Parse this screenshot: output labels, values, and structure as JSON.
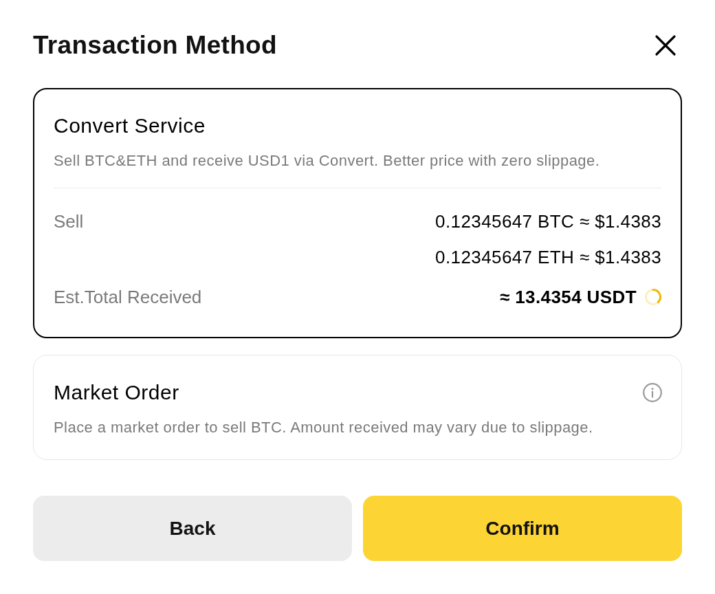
{
  "dialog": {
    "title": "Transaction Method"
  },
  "methods": [
    {
      "kind": "detailed",
      "selected": true,
      "title": "Convert Service",
      "description": "Sell BTC&ETH and receive USD1 via Convert. Better price with zero slippage.",
      "info": false,
      "rows": [
        {
          "kind": "line",
          "label": "Sell",
          "values": [
            "0.12345647 BTC ≈ $1.4383",
            "0.12345647 ETH ≈ $1.4383"
          ],
          "loading": false
        },
        {
          "kind": "total",
          "label": "Est.Total Received",
          "values": [
            "≈ 13.4354 USDT"
          ],
          "loading": true
        }
      ]
    },
    {
      "kind": "simple",
      "selected": false,
      "title": "Market Order",
      "description": "Place a market order to sell BTC. Amount received may vary due to slippage.",
      "info": true
    }
  ],
  "buttons": [
    {
      "kind": "secondary",
      "label": "Back"
    },
    {
      "kind": "primary",
      "label": "Confirm"
    }
  ]
}
